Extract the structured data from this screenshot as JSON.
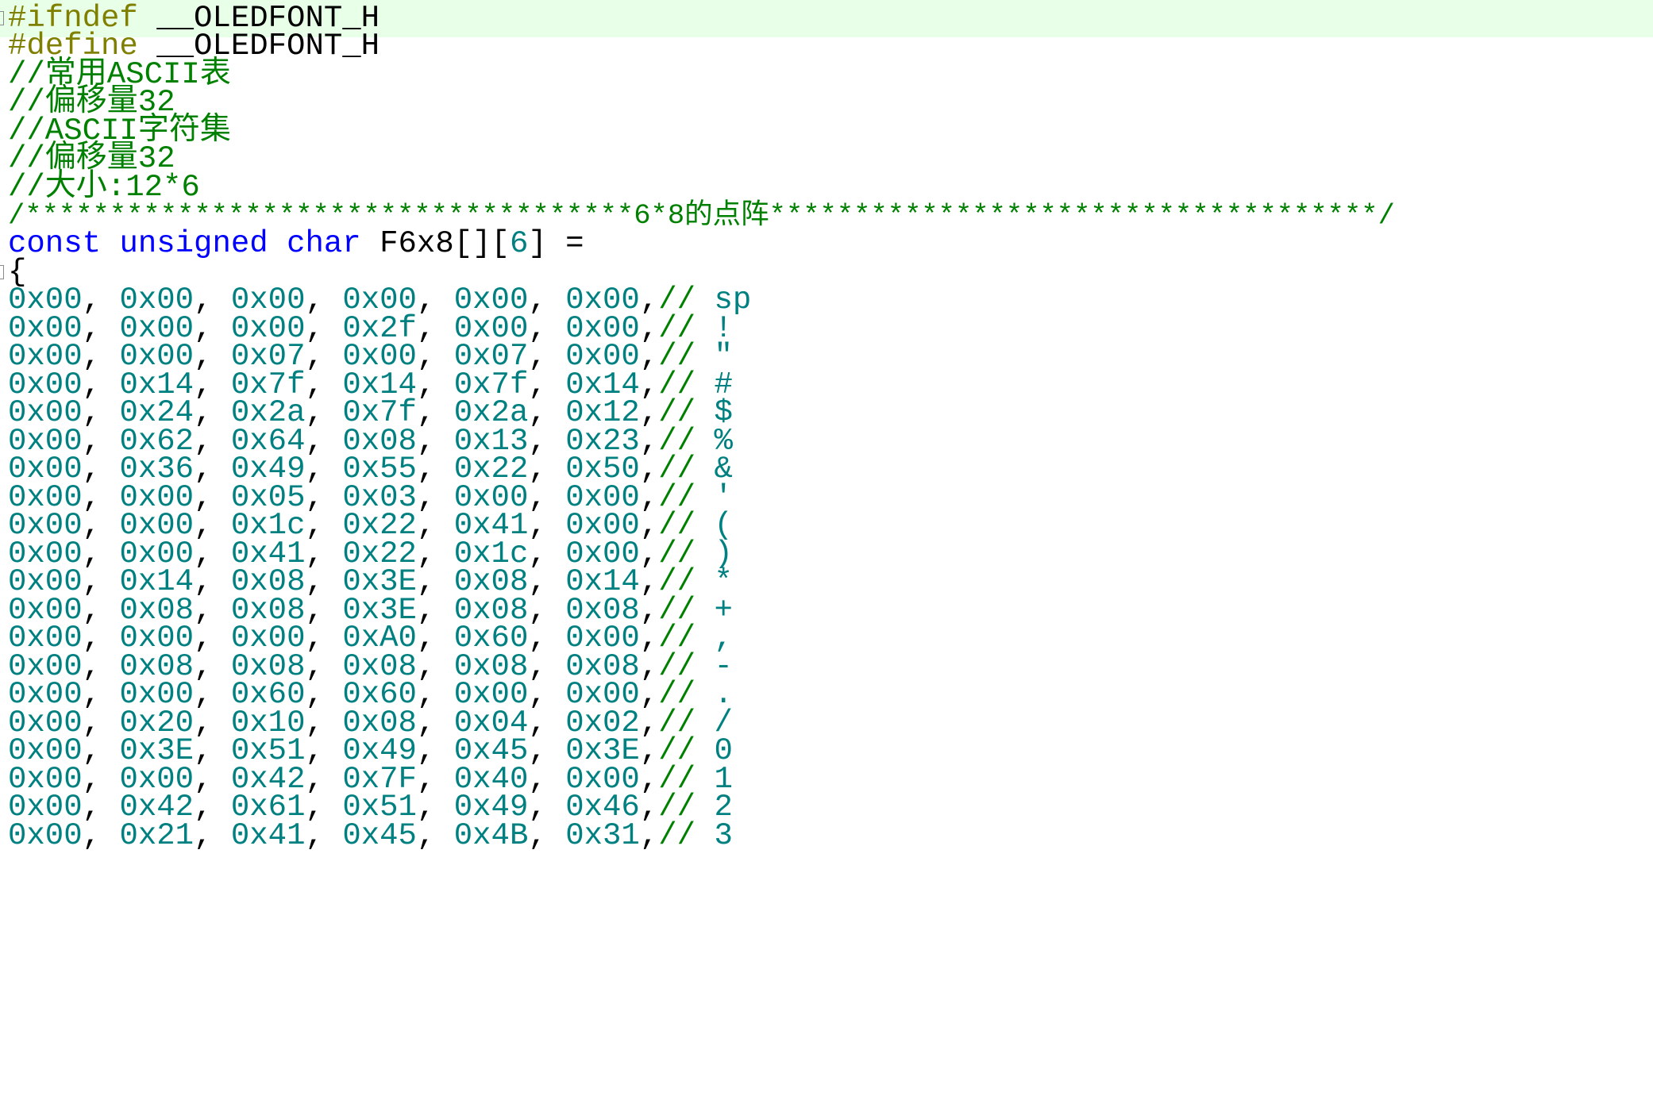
{
  "colors": {
    "preprocessor": "#808000",
    "comment": "#008000",
    "keyword": "#0000ff",
    "number": "#008080",
    "text": "#000000",
    "current_line": "#e8ffe8"
  },
  "header": {
    "ifndef_directive": "#ifndef",
    "ifndef_macro": "__OLEDFONT_H",
    "define_directive": "#define",
    "define_macro": "__OLEDFONT_H"
  },
  "comments": [
    "//常用ASCII表",
    "//偏移量32",
    "//ASCII字符集",
    "//偏移量32",
    "//大小:12*6",
    "/************************************6*8的点阵************************************/"
  ],
  "declaration": {
    "kw_const": "const",
    "kw_unsigned": "unsigned",
    "kw_char": "char",
    "identifier": "F6x8",
    "dims_open": "[][",
    "dim_size": "6",
    "dims_close": "]",
    "assign": "=",
    "open_brace": "{"
  },
  "rows": [
    {
      "bytes": [
        "0x00",
        "0x00",
        "0x00",
        "0x00",
        "0x00",
        "0x00"
      ],
      "char": "sp"
    },
    {
      "bytes": [
        "0x00",
        "0x00",
        "0x00",
        "0x2f",
        "0x00",
        "0x00"
      ],
      "char": "!"
    },
    {
      "bytes": [
        "0x00",
        "0x00",
        "0x07",
        "0x00",
        "0x07",
        "0x00"
      ],
      "char": "\""
    },
    {
      "bytes": [
        "0x00",
        "0x14",
        "0x7f",
        "0x14",
        "0x7f",
        "0x14"
      ],
      "char": "#"
    },
    {
      "bytes": [
        "0x00",
        "0x24",
        "0x2a",
        "0x7f",
        "0x2a",
        "0x12"
      ],
      "char": "$"
    },
    {
      "bytes": [
        "0x00",
        "0x62",
        "0x64",
        "0x08",
        "0x13",
        "0x23"
      ],
      "char": "%"
    },
    {
      "bytes": [
        "0x00",
        "0x36",
        "0x49",
        "0x55",
        "0x22",
        "0x50"
      ],
      "char": "&"
    },
    {
      "bytes": [
        "0x00",
        "0x00",
        "0x05",
        "0x03",
        "0x00",
        "0x00"
      ],
      "char": "'"
    },
    {
      "bytes": [
        "0x00",
        "0x00",
        "0x1c",
        "0x22",
        "0x41",
        "0x00"
      ],
      "char": "("
    },
    {
      "bytes": [
        "0x00",
        "0x00",
        "0x41",
        "0x22",
        "0x1c",
        "0x00"
      ],
      "char": ")"
    },
    {
      "bytes": [
        "0x00",
        "0x14",
        "0x08",
        "0x3E",
        "0x08",
        "0x14"
      ],
      "char": "*"
    },
    {
      "bytes": [
        "0x00",
        "0x08",
        "0x08",
        "0x3E",
        "0x08",
        "0x08"
      ],
      "char": "+"
    },
    {
      "bytes": [
        "0x00",
        "0x00",
        "0x00",
        "0xA0",
        "0x60",
        "0x00"
      ],
      "char": ","
    },
    {
      "bytes": [
        "0x00",
        "0x08",
        "0x08",
        "0x08",
        "0x08",
        "0x08"
      ],
      "char": "-"
    },
    {
      "bytes": [
        "0x00",
        "0x00",
        "0x60",
        "0x60",
        "0x00",
        "0x00"
      ],
      "char": "."
    },
    {
      "bytes": [
        "0x00",
        "0x20",
        "0x10",
        "0x08",
        "0x04",
        "0x02"
      ],
      "char": "/"
    },
    {
      "bytes": [
        "0x00",
        "0x3E",
        "0x51",
        "0x49",
        "0x45",
        "0x3E"
      ],
      "char": "0"
    },
    {
      "bytes": [
        "0x00",
        "0x00",
        "0x42",
        "0x7F",
        "0x40",
        "0x00"
      ],
      "char": "1"
    },
    {
      "bytes": [
        "0x00",
        "0x42",
        "0x61",
        "0x51",
        "0x49",
        "0x46"
      ],
      "char": "2"
    },
    {
      "bytes": [
        "0x00",
        "0x21",
        "0x41",
        "0x45",
        "0x4B",
        "0x31"
      ],
      "char": "3"
    }
  ]
}
